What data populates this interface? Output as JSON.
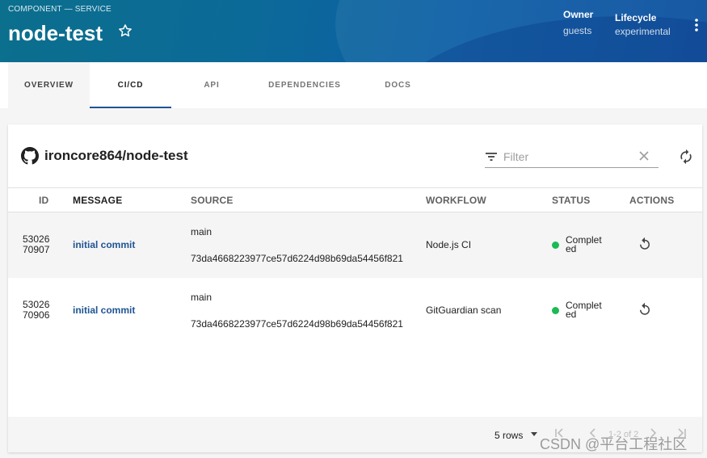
{
  "header": {
    "breadcrumb": "COMPONENT — SERVICE",
    "title": "node-test",
    "owner_label": "Owner",
    "owner_value": "guests",
    "lifecycle_label": "Lifecycle",
    "lifecycle_value": "experimental"
  },
  "tabs": [
    {
      "label": "OVERVIEW"
    },
    {
      "label": "CI/CD"
    },
    {
      "label": "API"
    },
    {
      "label": "DEPENDENCIES"
    },
    {
      "label": "DOCS"
    }
  ],
  "card": {
    "repo": "ironcore864/node-test",
    "filter_placeholder": "Filter",
    "columns": [
      "ID",
      "MESSAGE",
      "SOURCE",
      "WORKFLOW",
      "STATUS",
      "ACTIONS"
    ],
    "rows": [
      {
        "id_line1": "53026",
        "id_line2": "70907",
        "message": "initial commit",
        "branch": "main",
        "sha": "73da4668223977ce57d6224d98b69da54456f821",
        "workflow": "Node.js CI",
        "status": "Completed"
      },
      {
        "id_line1": "53026",
        "id_line2": "70906",
        "message": "initial commit",
        "branch": "main",
        "sha": "73da4668223977ce57d6224d98b69da54456f821",
        "workflow": "GitGuardian scan",
        "status": "Completed"
      }
    ],
    "footer": {
      "rows_per_page": "5 rows",
      "page_range": "1-2 of 2"
    }
  },
  "watermark": "CSDN @平台工程社区",
  "colors": {
    "link": "#1f5493",
    "status_success": "#1db954",
    "tab_active_indicator": "#1f5493"
  }
}
